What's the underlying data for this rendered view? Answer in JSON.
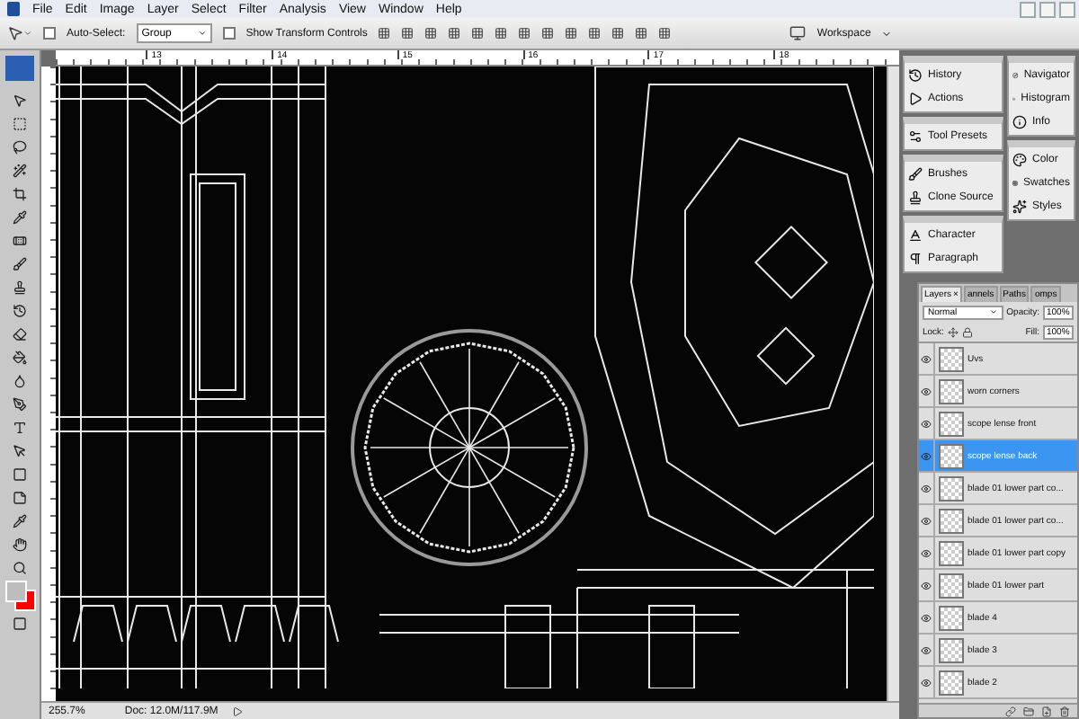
{
  "menu": [
    "File",
    "Edit",
    "Image",
    "Layer",
    "Select",
    "Filter",
    "Analysis",
    "View",
    "Window",
    "Help"
  ],
  "options": {
    "auto_select_label": "Auto-Select:",
    "auto_select_checked": false,
    "auto_select_value": "Group",
    "show_transform_label": "Show Transform Controls",
    "show_transform_checked": false,
    "workspace": "Workspace"
  },
  "ruler": {
    "ticks": [
      "13",
      "14",
      "15",
      "16",
      "17",
      "18"
    ]
  },
  "dock": {
    "columns": [
      [
        [
          "History",
          "Actions"
        ],
        [
          "Tool Presets"
        ],
        [
          "Brushes",
          "Clone Source"
        ],
        [
          "Character",
          "Paragraph"
        ]
      ],
      [
        [
          "Navigator",
          "Histogram",
          "Info"
        ],
        [
          "Color",
          "Swatches",
          "Styles"
        ]
      ]
    ]
  },
  "layers_panel": {
    "tabs": [
      {
        "label": "Layers",
        "selected": true
      },
      {
        "label": "annels",
        "selected": false
      },
      {
        "label": "Paths",
        "selected": false
      },
      {
        "label": "omps",
        "selected": false
      }
    ],
    "close": "×",
    "blend_mode": "Normal",
    "opacity_label": "Opacity:",
    "opacity": "100%",
    "lock_label": "Lock:",
    "fill_label": "Fill:",
    "fill": "100%",
    "layers": [
      {
        "name": "Uvs",
        "selected": false,
        "visible": true
      },
      {
        "name": "worn corners",
        "selected": false,
        "visible": true
      },
      {
        "name": "scope lense front",
        "selected": false,
        "visible": true
      },
      {
        "name": "scope lense back",
        "selected": true,
        "visible": true
      },
      {
        "name": "blade 01 lower part co...",
        "selected": false,
        "visible": true
      },
      {
        "name": "blade 01 lower part co...",
        "selected": false,
        "visible": true
      },
      {
        "name": "blade 01 lower part copy",
        "selected": false,
        "visible": true
      },
      {
        "name": "blade 01 lower part",
        "selected": false,
        "visible": true
      },
      {
        "name": "blade 4",
        "selected": false,
        "visible": true
      },
      {
        "name": "blade 3",
        "selected": false,
        "visible": true
      },
      {
        "name": "blade 2",
        "selected": false,
        "visible": true
      }
    ]
  },
  "status": {
    "zoom": "255.7%",
    "doc": "Doc: 12.0M/117.9M"
  }
}
